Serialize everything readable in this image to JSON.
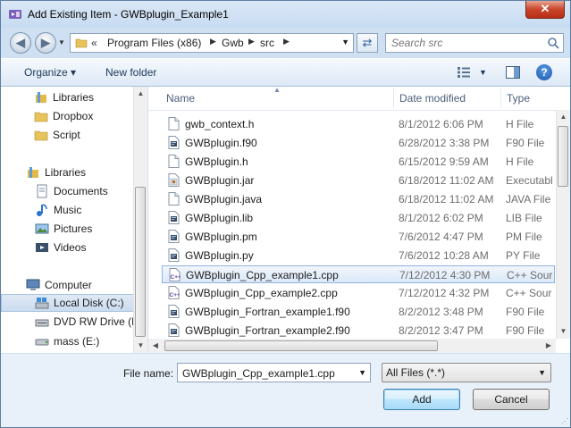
{
  "window": {
    "title": "Add Existing Item - GWBplugin_Example1",
    "close_label": "✕"
  },
  "address": {
    "chevron": "«",
    "crumbs": [
      "Program Files (x86)",
      "Gwb",
      "src"
    ]
  },
  "search": {
    "placeholder": "Search src"
  },
  "toolbar": {
    "organize": "Organize ▾",
    "new_folder": "New folder",
    "help": "?"
  },
  "nav": {
    "items": [
      {
        "label": "Libraries"
      },
      {
        "label": "Dropbox"
      },
      {
        "label": "Script"
      },
      {
        "label": "Libraries"
      },
      {
        "label": "Documents"
      },
      {
        "label": "Music"
      },
      {
        "label": "Pictures"
      },
      {
        "label": "Videos"
      },
      {
        "label": "Computer"
      },
      {
        "label": "Local Disk (C:)"
      },
      {
        "label": "DVD RW Drive (D"
      },
      {
        "label": "mass (E:)"
      }
    ]
  },
  "columns": {
    "name": "Name",
    "date": "Date modified",
    "type": "Type"
  },
  "files": [
    {
      "name": "gwb_context.h",
      "date": "8/1/2012 6:06 PM",
      "type": "H File",
      "icon": "blank-file-icon"
    },
    {
      "name": "GWBplugin.f90",
      "date": "6/28/2012 3:38 PM",
      "type": "F90 File",
      "icon": "code-file-icon"
    },
    {
      "name": "GWBplugin.h",
      "date": "6/15/2012 9:59 AM",
      "type": "H File",
      "icon": "blank-file-icon"
    },
    {
      "name": "GWBplugin.jar",
      "date": "6/18/2012 11:02 AM",
      "type": "Executabl",
      "icon": "jar-file-icon"
    },
    {
      "name": "GWBplugin.java",
      "date": "6/18/2012 11:02 AM",
      "type": "JAVA File",
      "icon": "blank-file-icon"
    },
    {
      "name": "GWBplugin.lib",
      "date": "8/1/2012 6:02 PM",
      "type": "LIB File",
      "icon": "code-file-icon"
    },
    {
      "name": "GWBplugin.pm",
      "date": "7/6/2012 4:47 PM",
      "type": "PM File",
      "icon": "code-file-icon"
    },
    {
      "name": "GWBplugin.py",
      "date": "7/6/2012 10:28 AM",
      "type": "PY File",
      "icon": "code-file-icon"
    },
    {
      "name": "GWBplugin_Cpp_example1.cpp",
      "date": "7/12/2012 4:30 PM",
      "type": "C++ Sour",
      "icon": "cpp-file-icon"
    },
    {
      "name": "GWBplugin_Cpp_example2.cpp",
      "date": "7/12/2012 4:32 PM",
      "type": "C++ Sour",
      "icon": "cpp-file-icon"
    },
    {
      "name": "GWBplugin_Fortran_example1.f90",
      "date": "8/2/2012 3:48 PM",
      "type": "F90 File",
      "icon": "code-file-icon"
    },
    {
      "name": "GWBplugin_Fortran_example2.f90",
      "date": "8/2/2012 3:47 PM",
      "type": "F90 File",
      "icon": "code-file-icon"
    }
  ],
  "selected_file_index": 8,
  "bottom": {
    "file_name_label": "File name:",
    "file_name_value": "GWBplugin_Cpp_example1.cpp",
    "filter": "All Files (*.*)",
    "add_label": "Add",
    "cancel_label": "Cancel"
  }
}
